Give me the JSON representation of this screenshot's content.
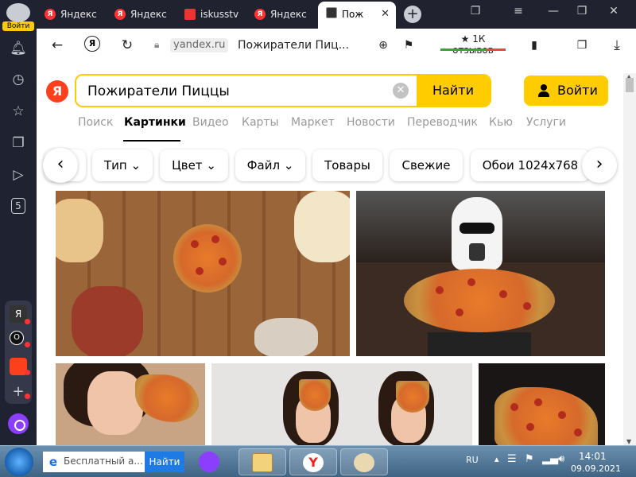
{
  "sidebar": {
    "login_label": "Войти",
    "icons": [
      "bell-icon",
      "history-icon",
      "star-icon",
      "collections-icon",
      "video-icon",
      "counter-icon"
    ],
    "counter": "5",
    "apps": [
      {
        "name": "yandex-app-icon",
        "glyph": "Я",
        "color": "#333333"
      },
      {
        "name": "music-app-icon",
        "glyph": "O",
        "color": "#111111"
      },
      {
        "name": "mail-app-icon",
        "glyph": "",
        "color": "#fc3f1d"
      },
      {
        "name": "add-app-icon",
        "glyph": "+",
        "color": "transparent"
      }
    ]
  },
  "tabs": [
    {
      "label": "Яндекс",
      "favicon": "Я",
      "type": "yandex"
    },
    {
      "label": "Яндекс",
      "favicon": "Я",
      "type": "yandex"
    },
    {
      "label": "iskusstv",
      "favicon": "",
      "type": "pdf"
    },
    {
      "label": "Яндекс",
      "favicon": "Я",
      "type": "yandex"
    },
    {
      "label": "Пож",
      "favicon": "",
      "type": "images",
      "active": true
    }
  ],
  "tab_close": "✕",
  "window_controls": {
    "minimize": "—",
    "restore": "❐",
    "close": "✕"
  },
  "address_bar": {
    "domain": "yandex.ru",
    "title": "Пожиратели Пиц...",
    "reviews": "★ 1К отзывов"
  },
  "search": {
    "logo": "Я",
    "query": "Пожиратели Пиццы",
    "button": "Найти",
    "login": "Войти"
  },
  "services": [
    {
      "label": "Поиск",
      "active": false
    },
    {
      "label": "Картинки",
      "active": true
    },
    {
      "label": "Видео",
      "active": false
    },
    {
      "label": "Карты",
      "active": false
    },
    {
      "label": "Маркет",
      "active": false
    },
    {
      "label": "Новости",
      "active": false
    },
    {
      "label": "Переводчик",
      "active": false
    },
    {
      "label": "Кью",
      "active": false
    },
    {
      "label": "Услуги",
      "active": false
    }
  ],
  "filters": [
    {
      "label": "Тип",
      "dropdown": true
    },
    {
      "label": "Цвет",
      "dropdown": true
    },
    {
      "label": "Файл",
      "dropdown": true
    },
    {
      "label": "Товары",
      "dropdown": false
    },
    {
      "label": "Свежие",
      "dropdown": false
    },
    {
      "label": "Обои 1024x768",
      "dropdown": false
    }
  ],
  "taskbar": {
    "search_placeholder": "Бесплатный а...",
    "search_button": "Найти",
    "language": "RU",
    "time": "14:01",
    "date": "09.09.2021"
  }
}
